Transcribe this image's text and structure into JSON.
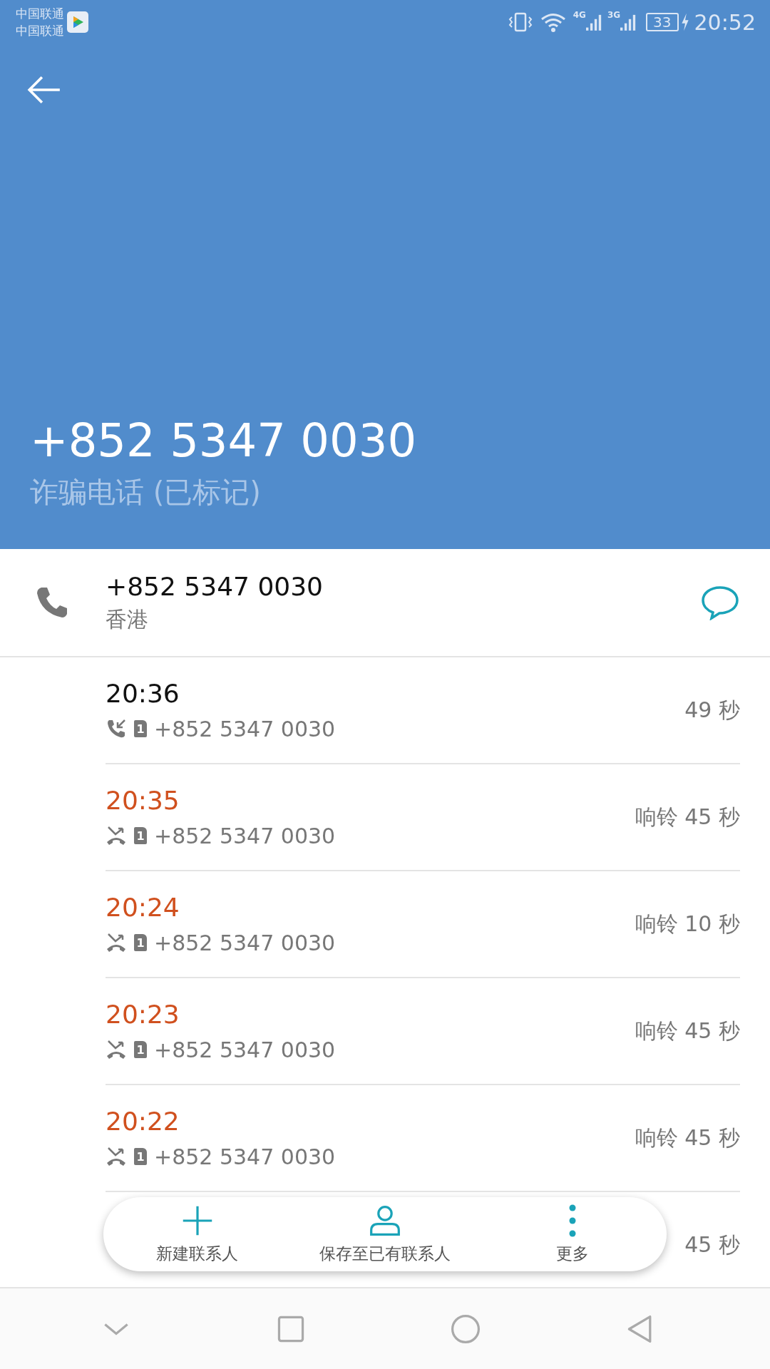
{
  "status_bar": {
    "carriers": [
      "中国联通",
      "中国联通"
    ],
    "networks": [
      "4G",
      "3G"
    ],
    "battery": "33",
    "time": "20:52"
  },
  "header": {
    "number": "+852 5347 0030",
    "label": "诈骗电话 (已标记)"
  },
  "contact": {
    "number": "+852 5347 0030",
    "region": "香港"
  },
  "calls": [
    {
      "kind": "incoming",
      "time": "20:36",
      "sim": "1",
      "number": "+852 5347 0030",
      "duration": "49 秒"
    },
    {
      "kind": "missed",
      "time": "20:35",
      "sim": "1",
      "number": "+852 5347 0030",
      "duration": "响铃 45 秒"
    },
    {
      "kind": "missed",
      "time": "20:24",
      "sim": "1",
      "number": "+852 5347 0030",
      "duration": "响铃 10 秒"
    },
    {
      "kind": "missed",
      "time": "20:23",
      "sim": "1",
      "number": "+852 5347 0030",
      "duration": "响铃 45 秒"
    },
    {
      "kind": "missed",
      "time": "20:22",
      "sim": "1",
      "number": "+852 5347 0030",
      "duration": "响铃 45 秒"
    }
  ],
  "covered_call": {
    "duration": "45 秒"
  },
  "actions": [
    {
      "kind": "add",
      "label": "新建联系人"
    },
    {
      "kind": "person",
      "label": "保存至已有联系人"
    },
    {
      "kind": "more",
      "label": "更多"
    }
  ]
}
